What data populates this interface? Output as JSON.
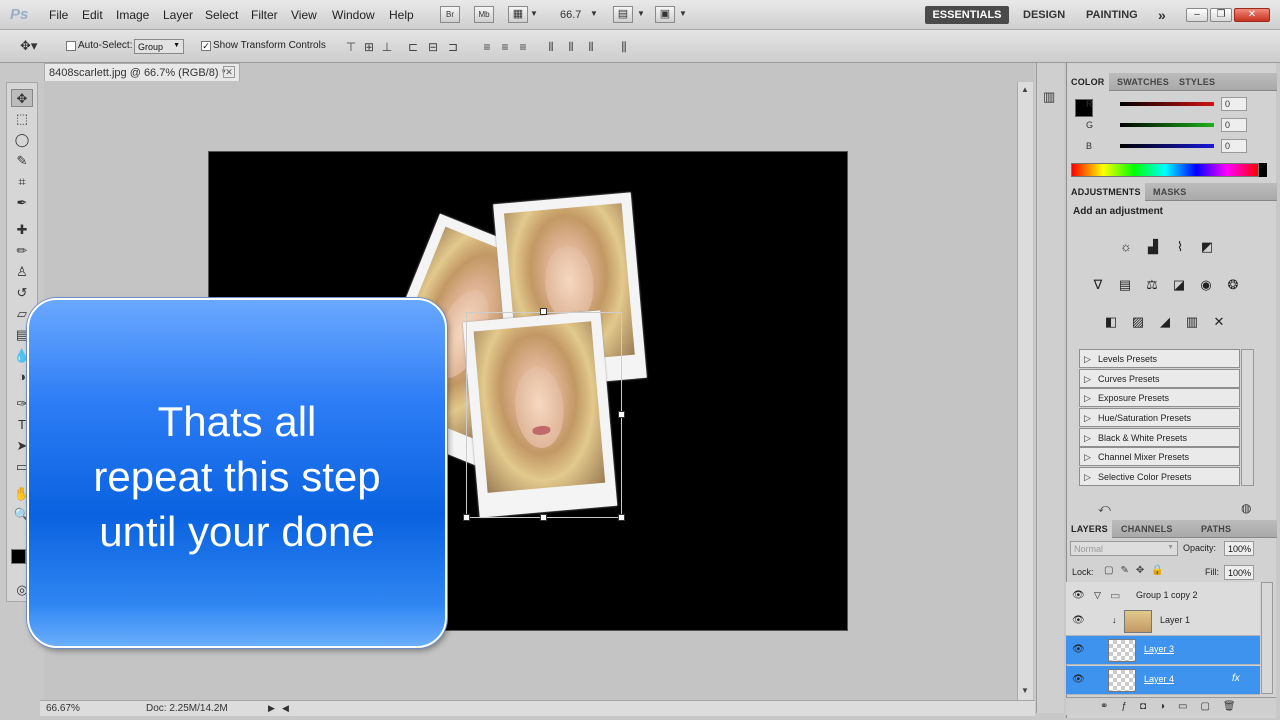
{
  "app": {
    "logo": "Ps"
  },
  "menu": [
    "File",
    "Edit",
    "Image",
    "Layer",
    "Select",
    "Filter",
    "View",
    "Window",
    "Help"
  ],
  "appbar": {
    "bridge_label": "Br",
    "minibridge_label": "Mb",
    "zoom": "66.7"
  },
  "workspaces": [
    "ESSENTIALS",
    "DESIGN",
    "PAINTING"
  ],
  "options": {
    "auto_select_label": "Auto-Select:",
    "auto_select_value": "Group",
    "transform_label": "Show Transform Controls"
  },
  "document": {
    "tab_title": "8408scarlett.jpg @ 66.7% (RGB/8) *",
    "close_glyph": "✕"
  },
  "status": {
    "zoom": "66.67%",
    "doc_info": "Doc: 2.25M/14.2M"
  },
  "color_panel": {
    "tabs": [
      "COLOR",
      "SWATCHES",
      "STYLES"
    ],
    "channels": [
      {
        "label": "R",
        "value": "0",
        "color": "#d21212"
      },
      {
        "label": "G",
        "value": "0",
        "color": "#1bb31b"
      },
      {
        "label": "B",
        "value": "0",
        "color": "#1818d8"
      }
    ]
  },
  "adjustments": {
    "tabs": [
      "ADJUSTMENTS",
      "MASKS"
    ],
    "heading": "Add an adjustment",
    "presets": [
      "Levels Presets",
      "Curves Presets",
      "Exposure Presets",
      "Hue/Saturation Presets",
      "Black & White Presets",
      "Channel Mixer Presets",
      "Selective Color Presets"
    ]
  },
  "layers": {
    "tabs": [
      "LAYERS",
      "CHANNELS",
      "PATHS"
    ],
    "blend_mode": "Normal",
    "opacity_label": "Opacity:",
    "opacity": "100%",
    "lock_label": "Lock:",
    "fill_label": "Fill:",
    "fill": "100%",
    "items": [
      {
        "name": "Group 1 copy 2",
        "type": "group",
        "selected": false
      },
      {
        "name": "Layer 1",
        "type": "layer",
        "selected": false
      },
      {
        "name": "Layer 3",
        "type": "layer",
        "selected": true
      },
      {
        "name": "Layer 4",
        "type": "layer",
        "selected": true,
        "fx": "fx"
      }
    ]
  },
  "callout": {
    "lines": [
      "Thats all",
      "repeat this step",
      "until your done"
    ]
  }
}
